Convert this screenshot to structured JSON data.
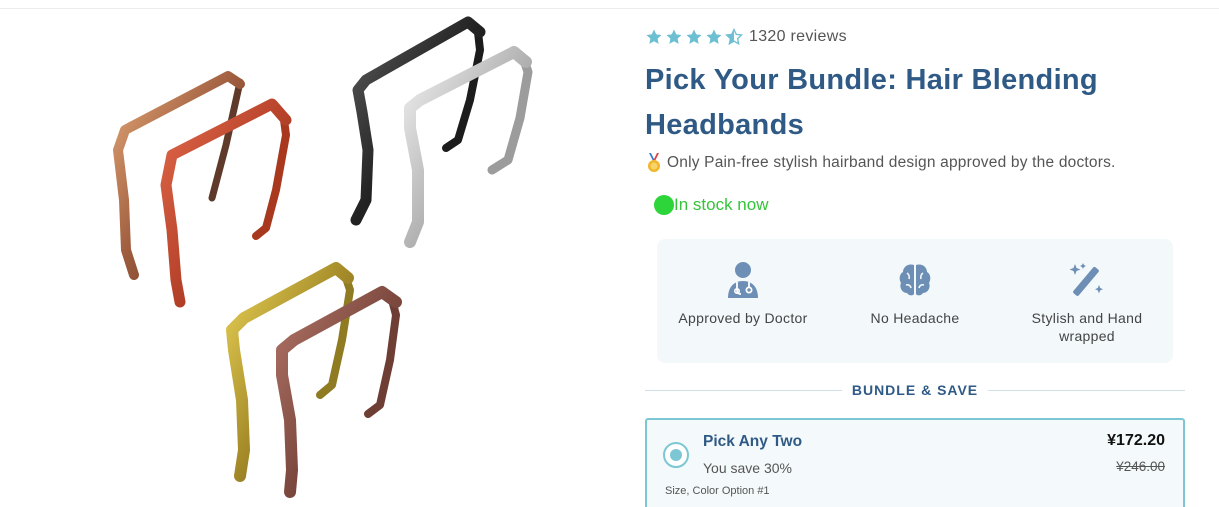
{
  "product": {
    "rating_value": 4.5,
    "rating_max": 5,
    "reviews_label": "1320 reviews",
    "title": "Pick Your Bundle: Hair Blending Headbands",
    "tagline": "Only Pain-free stylish hairband design approved by the doctors.",
    "stock_status": "In stock now"
  },
  "features": [
    {
      "icon": "doctor-icon",
      "label": "Approved by Doctor"
    },
    {
      "icon": "brain-icon",
      "label": "No Headache"
    },
    {
      "icon": "magic-wand-icon",
      "label": "Stylish and Hand wrapped"
    }
  ],
  "bundle_section": {
    "heading": "BUNDLE & SAVE",
    "options": [
      {
        "name": "Pick Any Two",
        "savings": "You save 30%",
        "option_label": "Size, Color Option #1",
        "price": "¥172.20",
        "original_price": "¥246.00",
        "selected": true
      }
    ]
  },
  "gallery": {
    "headband_colors": [
      "#b77a52",
      "#c24a2e",
      "#2a2a2a",
      "#b9b9b9",
      "#b89a2a",
      "#8b5547"
    ]
  },
  "colors": {
    "accent": "#2f5a86",
    "star": "#6cc0d2",
    "stock_green": "#35c43a",
    "bundle_border": "#7cc7d3"
  }
}
